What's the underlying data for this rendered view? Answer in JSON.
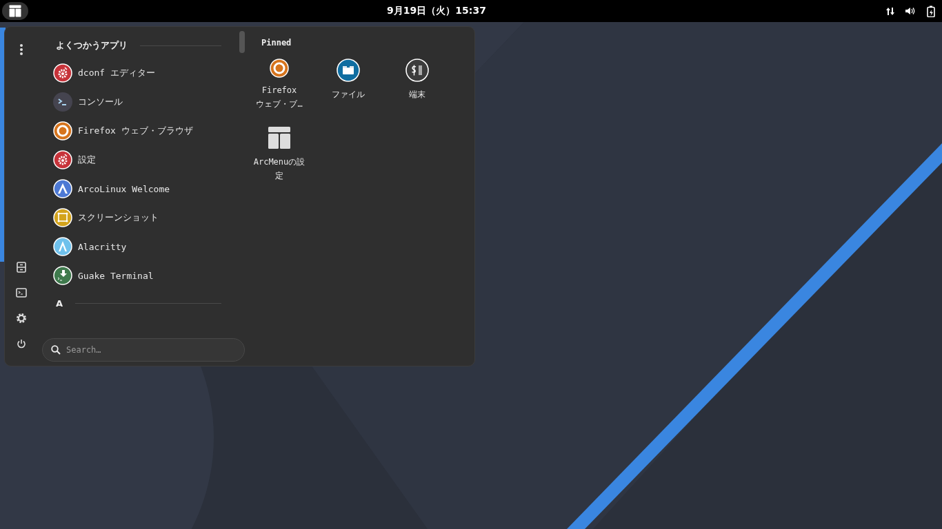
{
  "top_bar": {
    "clock": "9月19日（火）15:37"
  },
  "menu": {
    "sections": [
      {
        "title": "よくつかうアプリ",
        "apps": [
          {
            "name": "dconf エディター",
            "kind": "gear"
          },
          {
            "name": "コンソール",
            "kind": "console"
          },
          {
            "name": "Firefox ウェブ・ブラウザ",
            "kind": "firefox"
          },
          {
            "name": "設定",
            "kind": "gear"
          },
          {
            "name": "ArcoLinux Welcome",
            "kind": "arco"
          },
          {
            "name": "スクリーンショット",
            "kind": "screenshot"
          },
          {
            "name": "Alacritty",
            "kind": "alacritty"
          },
          {
            "name": "Guake Terminal",
            "kind": "guake"
          }
        ]
      },
      {
        "title": "A"
      }
    ],
    "pinned": {
      "title": "Pinned",
      "apps": [
        {
          "name": "Firefox ウェブ・ブ…",
          "kind": "firefox"
        },
        {
          "name": "ファイル",
          "kind": "files"
        },
        {
          "name": "端末",
          "kind": "terminal"
        },
        {
          "name": "ArcMenuの設定",
          "kind": "layout"
        }
      ]
    },
    "search": {
      "placeholder": "Search…"
    }
  }
}
